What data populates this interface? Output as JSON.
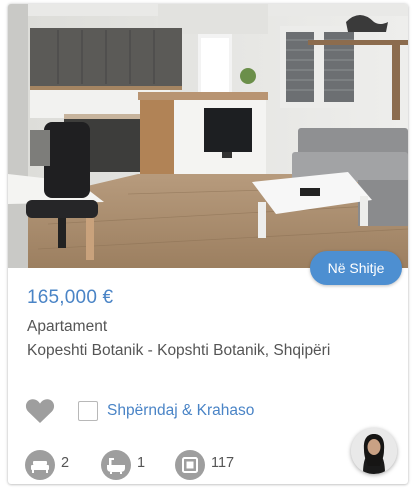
{
  "listing": {
    "price": "165,000 €",
    "status_badge": "Në Shitje",
    "property_type": "Apartament",
    "location": "Kopeshti Botanik - Kopshti Botanik, Shqipëri"
  },
  "actions": {
    "share_compare_label": "Shpërndaj & Krahaso",
    "favorite_icon": "heart-icon",
    "compare_checked": false
  },
  "features": [
    {
      "icon": "bed-icon",
      "value": "2"
    },
    {
      "icon": "bath-icon",
      "value": "1"
    },
    {
      "icon": "area-icon",
      "value": "117"
    }
  ],
  "colors": {
    "accent": "#4a84c6",
    "badge": "#4d8fd1",
    "icon_gray": "#9e9e9e"
  }
}
